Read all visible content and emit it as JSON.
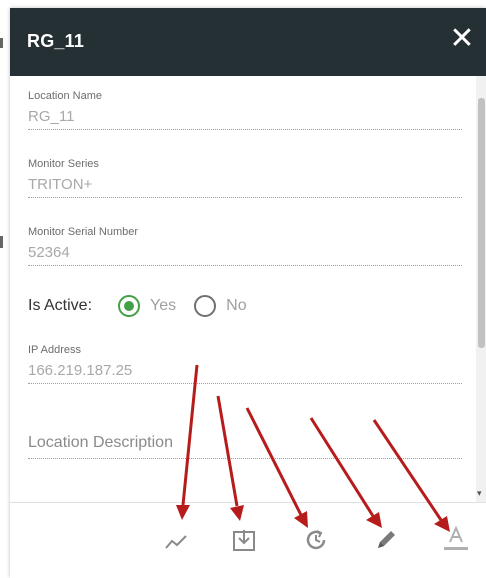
{
  "dialog": {
    "title": "RG_11",
    "close_glyph": "✕"
  },
  "fields": {
    "location_name": {
      "label": "Location Name",
      "value": "RG_11"
    },
    "monitor_series": {
      "label": "Monitor Series",
      "value": "TRITON+"
    },
    "monitor_serial": {
      "label": "Monitor Serial Number",
      "value": "52364"
    },
    "ip_address": {
      "label": "IP Address",
      "value": "166.219.187.25"
    },
    "location_description": {
      "placeholder": "Location Description"
    }
  },
  "is_active": {
    "label": "Is Active:",
    "options": [
      "Yes",
      "No"
    ],
    "selected": "Yes"
  },
  "toolbar": {
    "icons": [
      "chart-line-icon",
      "download-icon",
      "history-icon",
      "edit-pencil-icon",
      "text-format-icon"
    ]
  },
  "colors": {
    "header_bg": "#253035",
    "radio_selected": "#43a047",
    "annotation_arrow": "#b71c1c"
  }
}
